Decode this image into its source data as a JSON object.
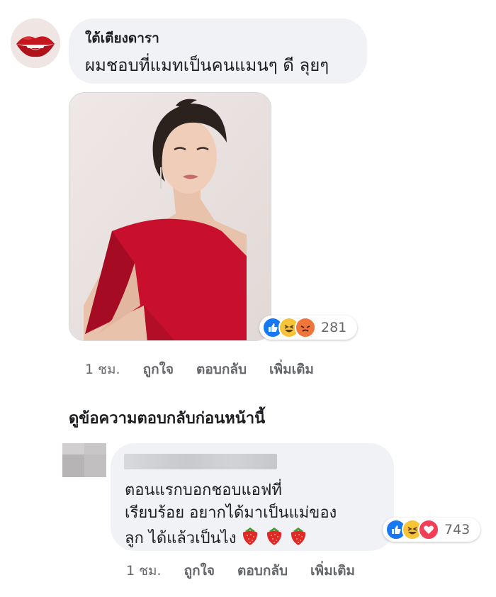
{
  "comment1": {
    "author": "ใต้เตียงดารา",
    "text": "ผมชอบที่แมทเป็นคนแมนๆ ดี ลุยๆ",
    "reactions_count": "281",
    "reaction_icons": [
      "like-icon",
      "haha-icon",
      "angry-icon"
    ],
    "actions": {
      "time": "1 ชม.",
      "like": "ถูกใจ",
      "reply": "ตอบกลับ",
      "more": "เพิ่มเติม"
    }
  },
  "view_previous_replies": "ดูข้อความตอบกลับก่อนหน้านี้",
  "reply1": {
    "text_line1": "ตอนแรกบอกชอบแอฟที่",
    "text_line2": "เรียบร้อย อยากได้มาเป็นแม่ของ",
    "text_line3": "ลูก ได้แล้วเป็นไง",
    "emoji": [
      "strawberry-icon",
      "strawberry-icon",
      "strawberry-icon"
    ],
    "reactions_count": "743",
    "reaction_icons": [
      "like-icon",
      "haha-icon",
      "love-icon"
    ],
    "actions": {
      "time": "1 ชม.",
      "like": "ถูกใจ",
      "reply": "ตอบกลับ",
      "more": "เพิ่มเติม"
    }
  },
  "colors": {
    "bubble": "#f0f2f5",
    "meta_text": "#65676b",
    "like_blue": "#1877f2",
    "dress_red": "#c8102e"
  }
}
